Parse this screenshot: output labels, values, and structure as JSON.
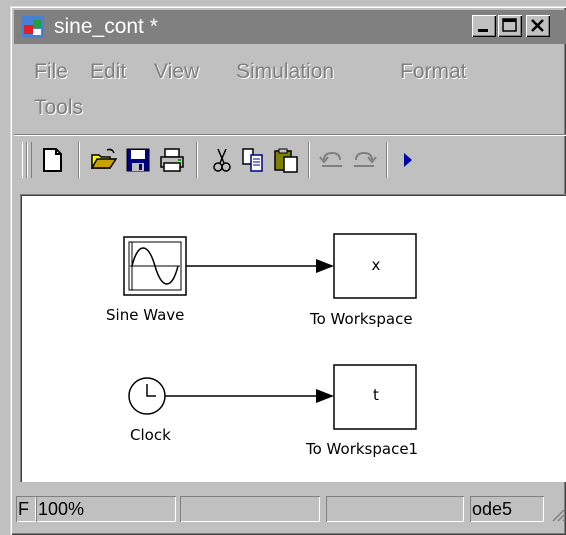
{
  "window": {
    "title": "sine_cont *"
  },
  "menu": {
    "items": [
      "File",
      "Edit",
      "View",
      "Simulation",
      "Format",
      "Tools"
    ]
  },
  "toolbar": {
    "icons": [
      "new-model-icon",
      "open-icon",
      "save-icon",
      "print-icon",
      "cut-icon",
      "copy-icon",
      "paste-icon",
      "undo-icon",
      "redo-icon",
      "start-simulation-icon"
    ]
  },
  "diagram": {
    "sine_wave": {
      "label": "Sine Wave"
    },
    "to_workspace": {
      "label": "To Workspace",
      "variable": "x"
    },
    "clock": {
      "label": "Clock"
    },
    "to_workspace1": {
      "label": "To Workspace1",
      "variable": "t"
    }
  },
  "status": {
    "left_cut": "F",
    "zoom": "100%",
    "solver": "ode5"
  },
  "colors": {
    "face": "#c0c0c0",
    "disabled_text": "#808080",
    "canvas": "#ffffff",
    "run_arrow": "#0000aa"
  }
}
